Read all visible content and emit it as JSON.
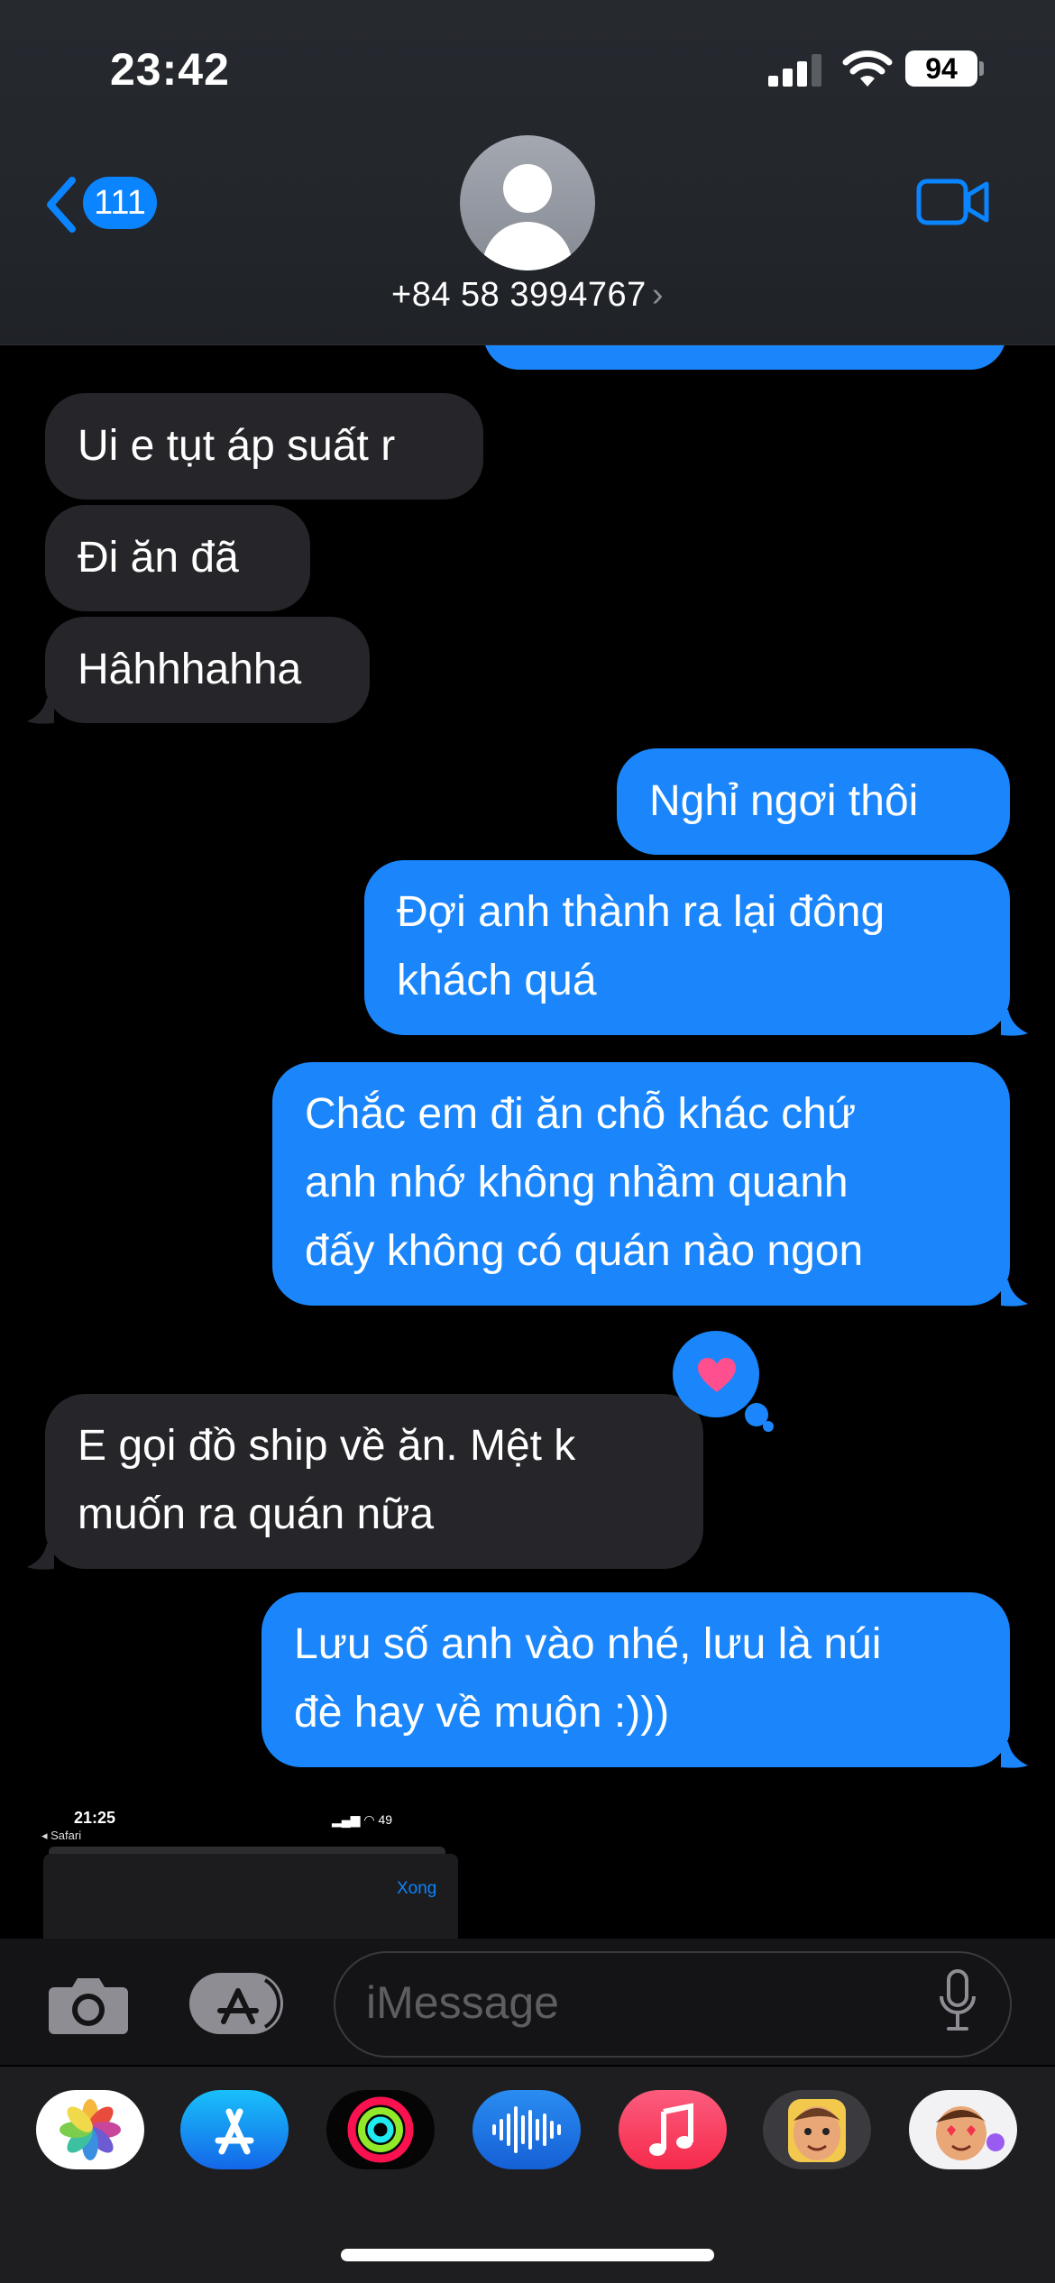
{
  "status_bar": {
    "time": "23:42",
    "battery": "94"
  },
  "header": {
    "back_badge": "111",
    "contact": "+84 58 3994767",
    "contact_chevron": "›"
  },
  "messages": [
    {
      "side": "received",
      "text": "Ui e tụt áp suất r"
    },
    {
      "side": "received",
      "text": "Đi ăn đã"
    },
    {
      "side": "received",
      "text": "Hâhhhahha"
    },
    {
      "side": "sent",
      "text": "Nghỉ ngơi thôi"
    },
    {
      "side": "sent",
      "lines": [
        "Đợi anh thành ra lại đông",
        "khách quá"
      ]
    },
    {
      "side": "sent",
      "lines": [
        "Chắc em đi ăn chỗ khác chứ",
        "anh nhớ không nhầm quanh",
        "đấy không có quán nào ngon"
      ]
    },
    {
      "side": "received",
      "lines": [
        "E gọi đồ ship về ăn. Mệt k",
        "muốn ra quán nữa"
      ],
      "reaction": "heart"
    },
    {
      "side": "sent",
      "lines": [
        "Lưu số anh vào nhé, lưu là núi",
        "đè hay về muộn :)))"
      ]
    }
  ],
  "attachment_screenshot": {
    "time": "21:25",
    "back_label": "◂ Safari",
    "battery": "49",
    "done_label": "Xong"
  },
  "input": {
    "placeholder": "iMessage"
  },
  "app_drawer": [
    "photos-icon",
    "app-store-icon",
    "fitness-icon",
    "voice-memos-icon",
    "music-icon",
    "memoji-icon",
    "memoji-stickers-icon"
  ],
  "colors": {
    "sent": "#1b86fb",
    "received": "#26252a",
    "accent": "#0a84ff"
  }
}
